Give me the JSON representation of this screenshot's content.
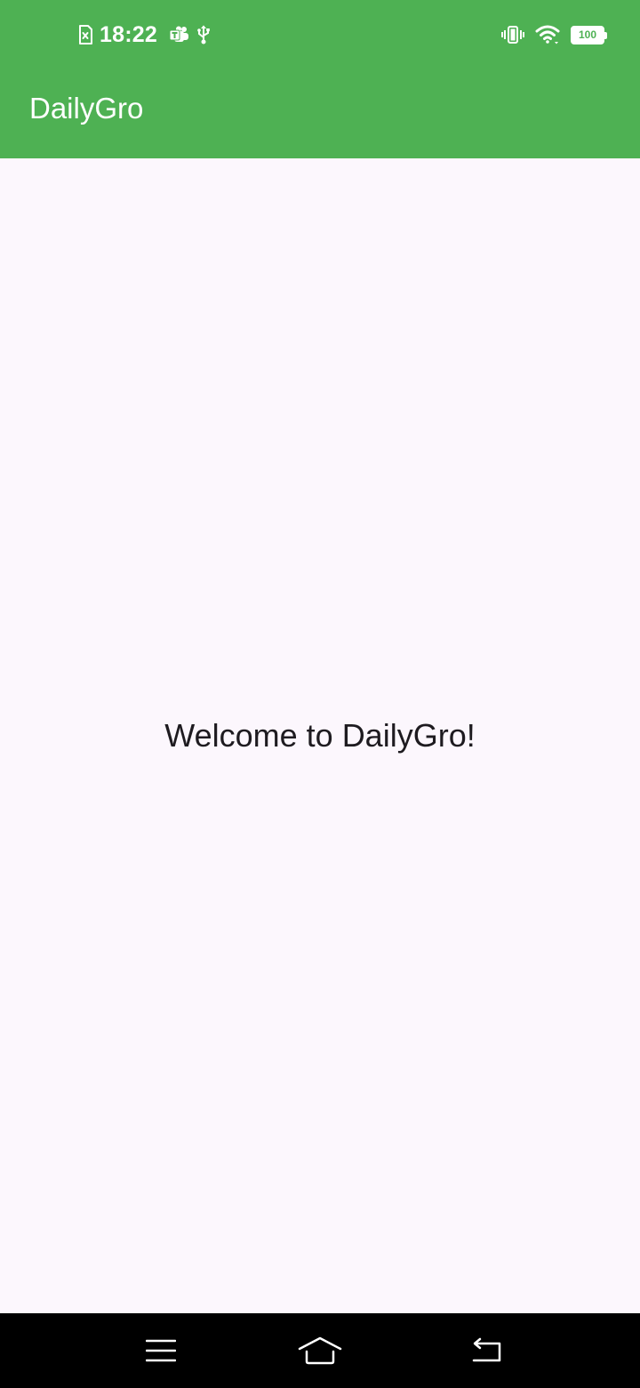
{
  "status_bar": {
    "time": "18:22",
    "battery_level": "100",
    "left_icons": [
      "sim-error-icon",
      "teams-icon",
      "usb-icon"
    ],
    "right_icons": [
      "vibrate-icon",
      "wifi-icon",
      "battery-icon"
    ]
  },
  "app_bar": {
    "title": "DailyGro",
    "color": "#4eb153"
  },
  "main": {
    "welcome_text": "Welcome to DailyGro!",
    "background": "#fcf7fd"
  },
  "nav_bar": {
    "buttons": [
      "menu-icon",
      "home-icon",
      "back-icon"
    ]
  }
}
